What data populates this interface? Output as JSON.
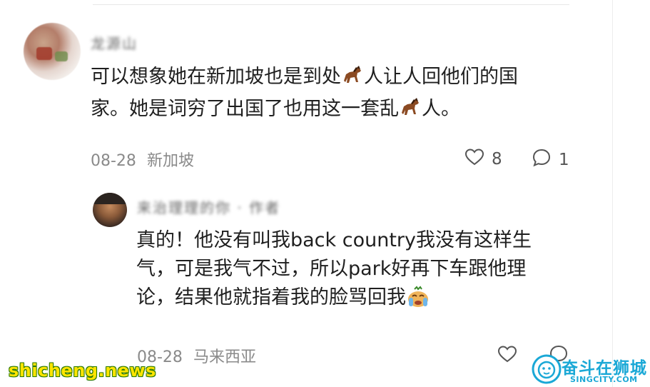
{
  "comment1": {
    "username": "龙源山",
    "line1_before": "可以想象她在新加坡也是到处",
    "line1_after": "人让人回他们的国",
    "line2_before": "家。她是词穷了出国了也用这一套乱",
    "line2_after": "人。",
    "emoji": "horse-emoji",
    "date": "08-28",
    "location": "新加坡",
    "likes": "8",
    "replies": "1"
  },
  "comment2": {
    "username": "来治理理的你 · 作者",
    "line1": "真的！他没有叫我back country我没有这样生",
    "line2": "气，可是我气不过，所以park好再下车跟他理",
    "line3": "论，结果他就指着我的脸骂回我",
    "emoji": "crying-face-emoji",
    "date": "08-28",
    "location": "马来西亚"
  },
  "watermarks": {
    "left": "shicheng.news",
    "right_cn": "奋斗在狮城",
    "right_en": "SINGCITY.COM"
  },
  "colors": {
    "text": "#1f1f1f",
    "meta": "#8a8a8a",
    "watermark_left": "#ffe500",
    "watermark_right": "#1aa8d6"
  }
}
